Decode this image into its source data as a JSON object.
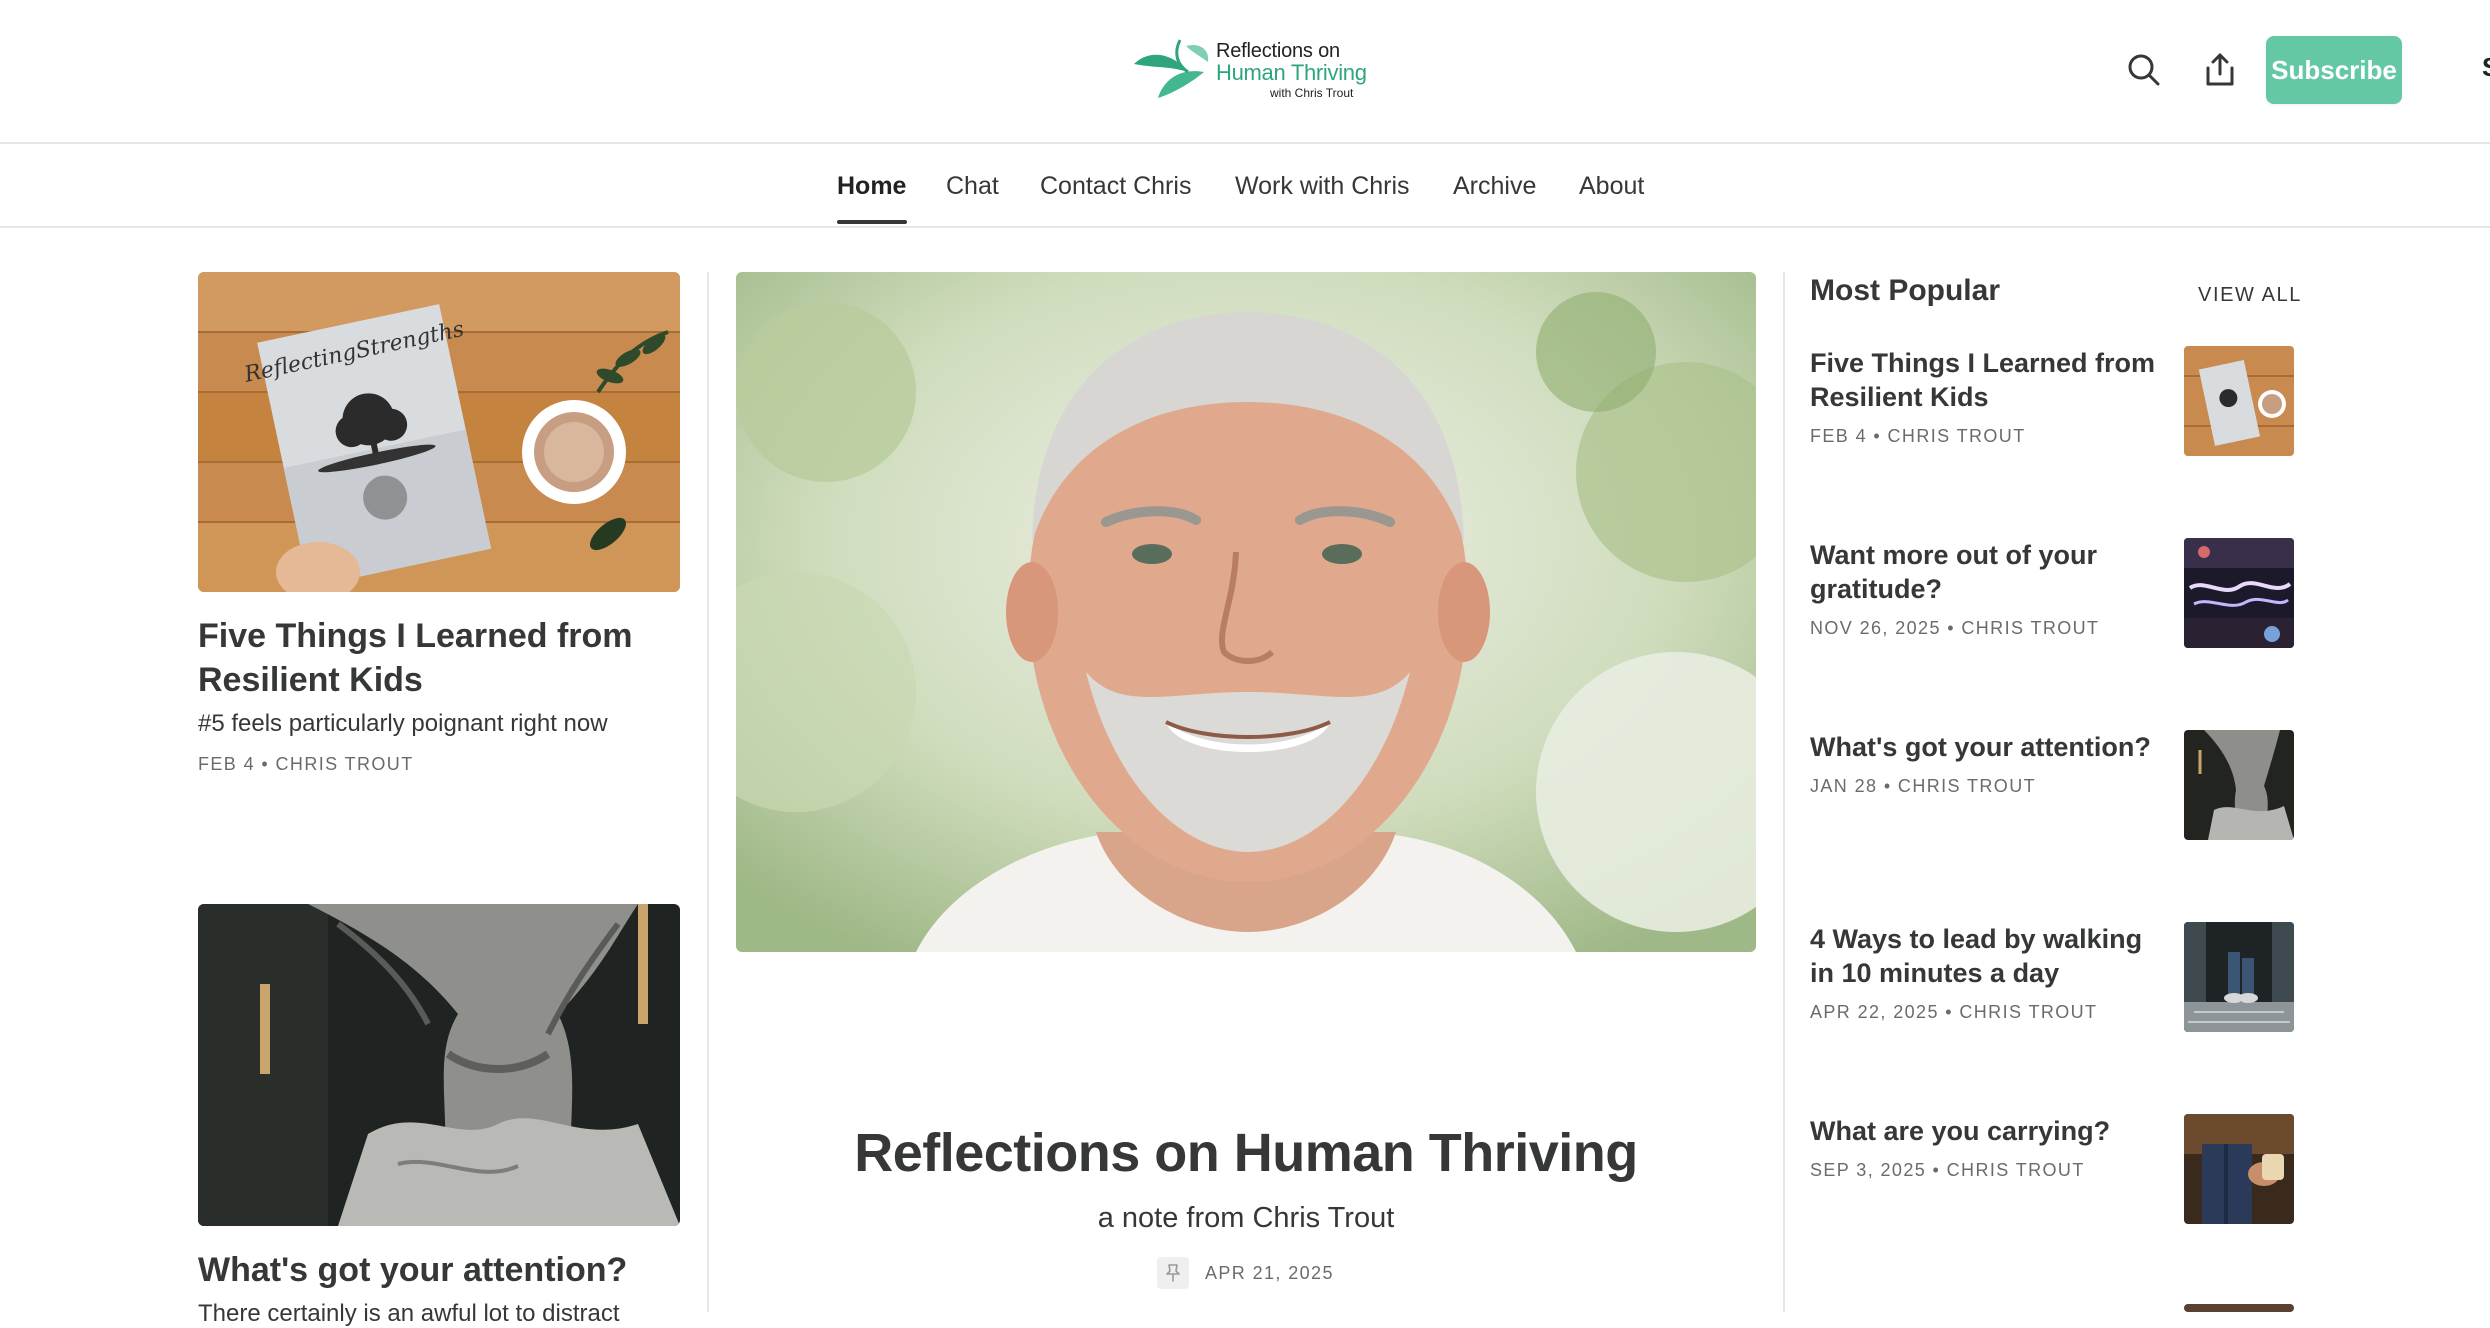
{
  "header": {
    "logo": {
      "line1": "Reflections on",
      "line2": "Human Thriving",
      "line3": "with Chris Trout"
    },
    "search_icon": "search-icon",
    "share_icon": "share-icon",
    "subscribe_label": "Subscribe",
    "edge_text": "S"
  },
  "nav": {
    "items": [
      {
        "label": "Home",
        "active": true
      },
      {
        "label": "Chat"
      },
      {
        "label": "Contact Chris"
      },
      {
        "label": "Work with Chris"
      },
      {
        "label": "Archive"
      },
      {
        "label": "About"
      }
    ]
  },
  "left_posts": [
    {
      "title": "Five Things I Learned from Resilient Kids",
      "subtitle": "#5 feels particularly poignant right now",
      "meta": "FEB 4 • CHRIS TROUT",
      "cover_text": "ReflectingStrengths"
    },
    {
      "title": "What's got your attention?",
      "subtitle": "There certainly is an awful lot to distract"
    }
  ],
  "featured": {
    "title": "Reflections on Human Thriving",
    "subtitle": "a note from Chris Trout",
    "date": "APR 21, 2025",
    "pin_icon": "pin-icon"
  },
  "most_popular": {
    "heading": "Most Popular",
    "view_all": "VIEW ALL",
    "items": [
      {
        "title": "Five Things I Learned from Resilient Kids",
        "meta": "FEB 4 • CHRIS TROUT"
      },
      {
        "title": "Want more out of your gratitude?",
        "meta": "NOV 26, 2025 • CHRIS TROUT"
      },
      {
        "title": "What's got your attention?",
        "meta": "JAN 28 • CHRIS TROUT"
      },
      {
        "title": "4 Ways to lead by walking in 10 minutes a day",
        "meta": "APR 22, 2025 • CHRIS TROUT"
      },
      {
        "title": "What are you carrying?",
        "meta": "SEP 3, 2025 • CHRIS TROUT"
      }
    ]
  },
  "colors": {
    "accent": "#64c8a5",
    "logo_green": "#2fa57f",
    "text": "#363737",
    "meta": "#6b6b6b",
    "divider": "#e6e6e6"
  }
}
